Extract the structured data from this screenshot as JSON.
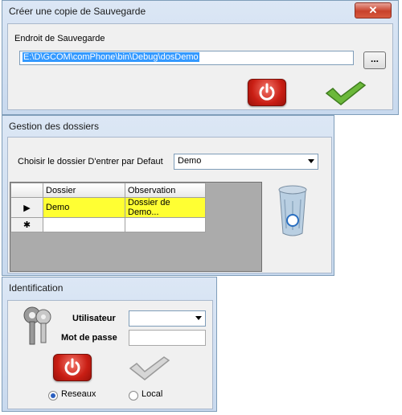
{
  "backup": {
    "title": "Créer une copie de Sauvegarde",
    "close": "✕",
    "location_label": "Endroit de Sauvegarde",
    "path": "E:\\D\\GCOM\\comPhone\\bin\\Debug\\dosDemo",
    "browse": "..."
  },
  "folders": {
    "title": "Gestion des dossiers",
    "default_label": "Choisir le dossier D'entrer par Defaut",
    "default_value": "Demo",
    "columns": [
      "Dossier",
      "Observation"
    ],
    "rows": [
      {
        "marker": "▶",
        "dossier": "Demo",
        "observation": "Dossier de Demo..."
      }
    ],
    "new_row_marker": "✱"
  },
  "login": {
    "title": "Identification",
    "user_label": "Utilisateur",
    "user_value": "",
    "password_label": "Mot de passe",
    "password_value": "",
    "radio_network": "Reseaux",
    "radio_local": "Local",
    "selected_mode": "Reseaux"
  },
  "icons": {
    "power": "power-icon",
    "check": "check-icon",
    "recycle": "recycle-bin-icon",
    "keys": "keys-icon"
  },
  "colors": {
    "selection": "#3399ff",
    "row_highlight": "#ffff33",
    "power_red": "#c91e14",
    "check_green": "#6bb83a"
  }
}
